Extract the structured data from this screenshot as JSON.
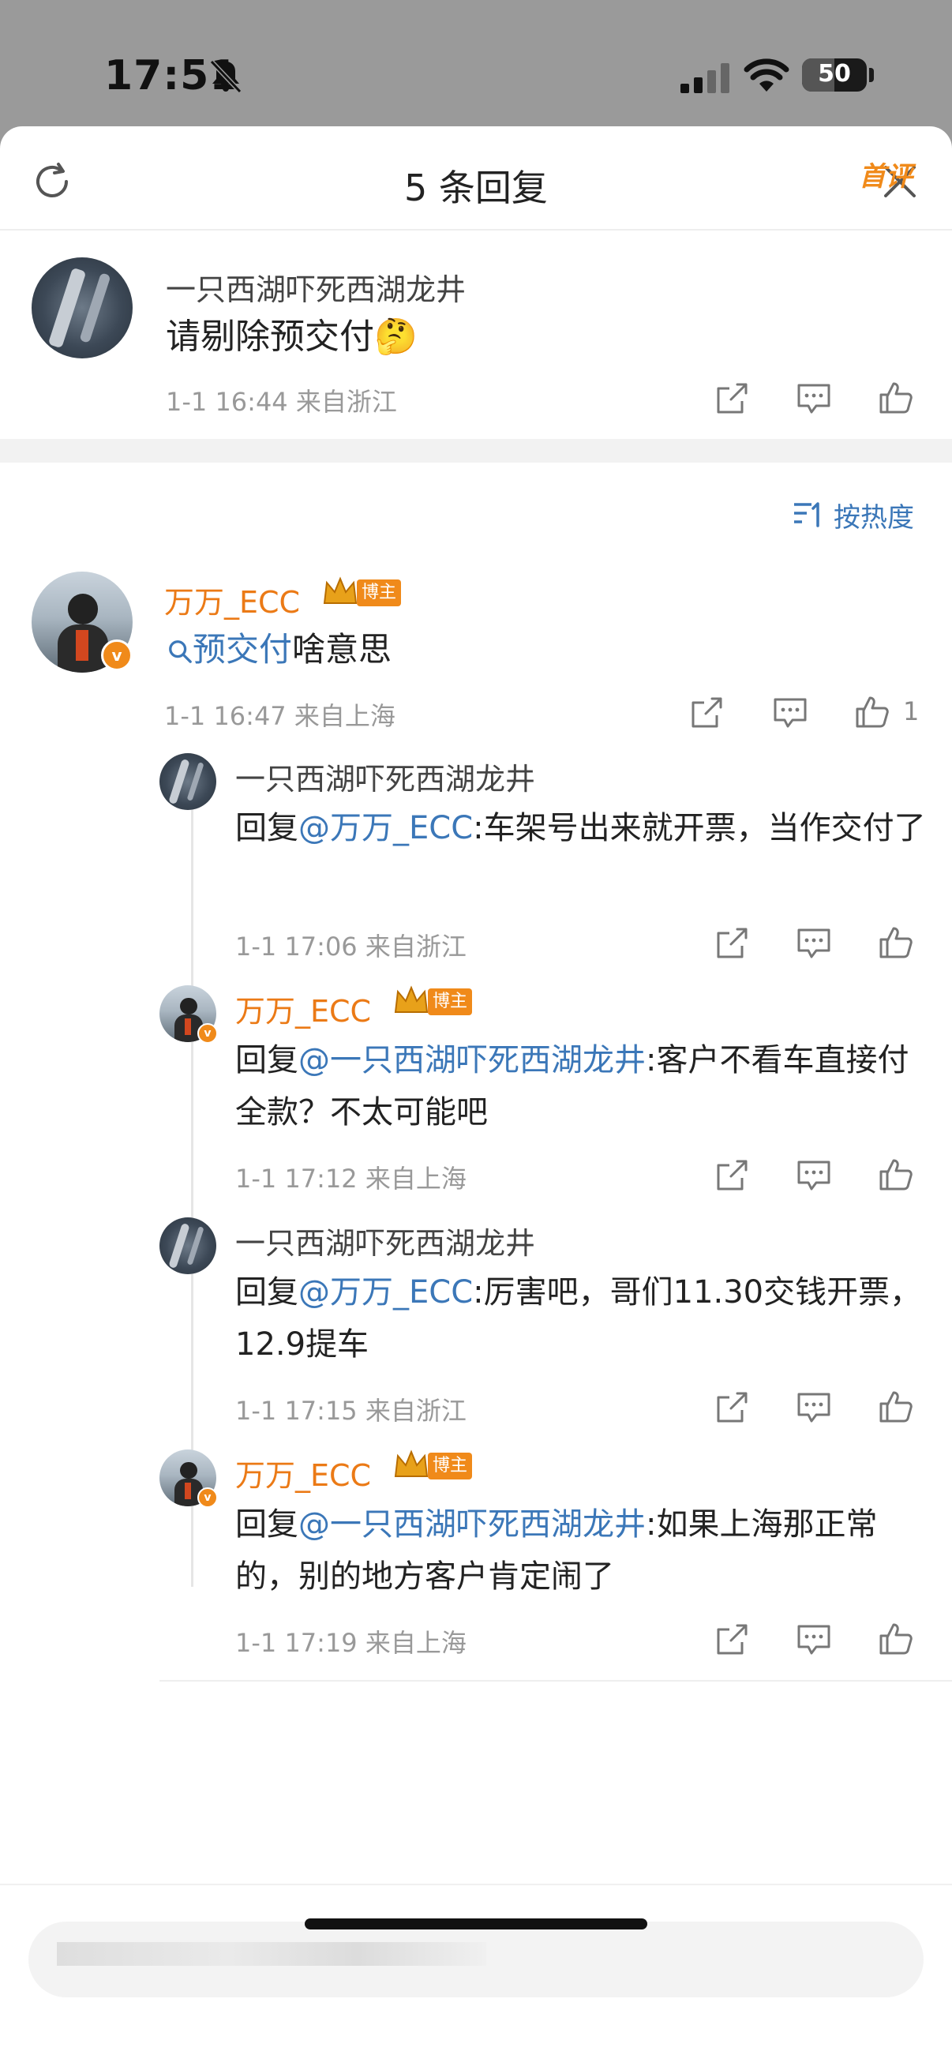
{
  "status_bar": {
    "time": "17:51",
    "battery": "50"
  },
  "header": {
    "title": "5 条回复"
  },
  "root_comment": {
    "user": "一只西湖吓死西湖龙井",
    "text": "请剔除预交付",
    "emoji": "🤔",
    "tag": "首评",
    "time": "1-1 16:44",
    "location": "来自浙江"
  },
  "sort": {
    "label": "按热度"
  },
  "reply": {
    "user": "万万_ECC",
    "badge": "博主",
    "search_link": "预交付",
    "text_rest": "啥意思",
    "time": "1-1 16:47",
    "location": "来自上海",
    "like_count": "1"
  },
  "sub_replies": [
    {
      "user": "一只西湖吓死西湖龙井",
      "prefix": "回复",
      "mention": "@万万_ECC",
      "text": ":车架号出来就开票，当作交付了",
      "time": "1-1 17:06",
      "location": "来自浙江"
    },
    {
      "user": "万万_ECC",
      "badge": "博主",
      "prefix": "回复",
      "mention": "@一只西湖吓死西湖龙井",
      "text": ":客户不看车直接付全款？不太可能吧",
      "time": "1-1 17:12",
      "location": "来自上海"
    },
    {
      "user": "一只西湖吓死西湖龙井",
      "prefix": "回复",
      "mention": "@万万_ECC",
      "text": ":厉害吧，哥们11.30交钱开票，12.9提车",
      "time": "1-1 17:15",
      "location": "来自浙江"
    },
    {
      "user": "万万_ECC",
      "badge": "博主",
      "prefix": "回复",
      "mention": "@一只西湖吓死西湖龙井",
      "text": ":如果上海那正常的，别的地方客户肯定闹了",
      "time": "1-1 17:19",
      "location": "来自上海"
    }
  ],
  "input": {
    "placeholder": ""
  },
  "colors": {
    "accent_orange": "#eb7a16",
    "link_blue": "#3b77b8",
    "muted": "#999999"
  },
  "icons": [
    "refresh-icon",
    "close-icon",
    "share-icon",
    "comment-icon",
    "like-icon",
    "search-icon",
    "sort-icon",
    "crown-icon",
    "verified-icon"
  ]
}
